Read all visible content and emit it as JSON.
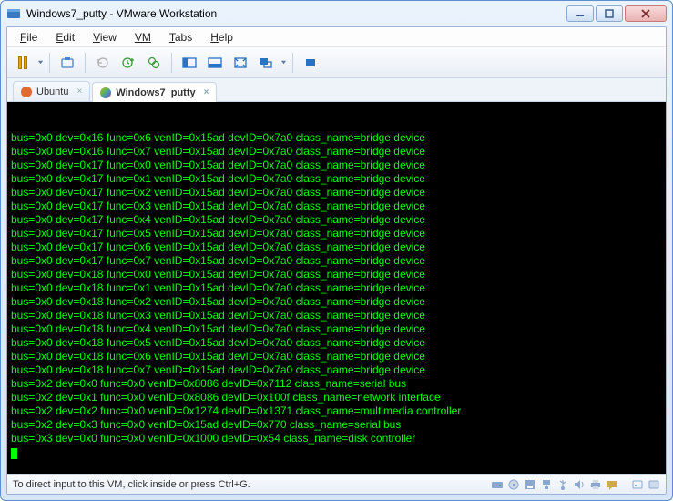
{
  "window": {
    "title": "Windows7_putty - VMware Workstation"
  },
  "menu": {
    "file": "File",
    "edit": "Edit",
    "view": "View",
    "vm": "VM",
    "tabs": "Tabs",
    "help": "Help"
  },
  "tabs": [
    {
      "label": "Ubuntu",
      "active": false,
      "icon_color": "#e26a2c"
    },
    {
      "label": "Windows7_putty",
      "active": true,
      "icon_color": "#2a72c4"
    }
  ],
  "terminal": {
    "lines": [
      "bus=0x0 dev=0x16 func=0x6 venID=0x15ad devID=0x7a0 class_name=bridge device",
      "bus=0x0 dev=0x16 func=0x7 venID=0x15ad devID=0x7a0 class_name=bridge device",
      "bus=0x0 dev=0x17 func=0x0 venID=0x15ad devID=0x7a0 class_name=bridge device",
      "bus=0x0 dev=0x17 func=0x1 venID=0x15ad devID=0x7a0 class_name=bridge device",
      "bus=0x0 dev=0x17 func=0x2 venID=0x15ad devID=0x7a0 class_name=bridge device",
      "bus=0x0 dev=0x17 func=0x3 venID=0x15ad devID=0x7a0 class_name=bridge device",
      "bus=0x0 dev=0x17 func=0x4 venID=0x15ad devID=0x7a0 class_name=bridge device",
      "bus=0x0 dev=0x17 func=0x5 venID=0x15ad devID=0x7a0 class_name=bridge device",
      "bus=0x0 dev=0x17 func=0x6 venID=0x15ad devID=0x7a0 class_name=bridge device",
      "bus=0x0 dev=0x17 func=0x7 venID=0x15ad devID=0x7a0 class_name=bridge device",
      "bus=0x0 dev=0x18 func=0x0 venID=0x15ad devID=0x7a0 class_name=bridge device",
      "bus=0x0 dev=0x18 func=0x1 venID=0x15ad devID=0x7a0 class_name=bridge device",
      "bus=0x0 dev=0x18 func=0x2 venID=0x15ad devID=0x7a0 class_name=bridge device",
      "bus=0x0 dev=0x18 func=0x3 venID=0x15ad devID=0x7a0 class_name=bridge device",
      "bus=0x0 dev=0x18 func=0x4 venID=0x15ad devID=0x7a0 class_name=bridge device",
      "bus=0x0 dev=0x18 func=0x5 venID=0x15ad devID=0x7a0 class_name=bridge device",
      "bus=0x0 dev=0x18 func=0x6 venID=0x15ad devID=0x7a0 class_name=bridge device",
      "bus=0x0 dev=0x18 func=0x7 venID=0x15ad devID=0x7a0 class_name=bridge device",
      "bus=0x2 dev=0x0 func=0x0 venID=0x8086 devID=0x7112 class_name=serial bus",
      "bus=0x2 dev=0x1 func=0x0 venID=0x8086 devID=0x100f class_name=network interface",
      "bus=0x2 dev=0x2 func=0x0 venID=0x1274 devID=0x1371 class_name=multimedia controller",
      "bus=0x2 dev=0x3 func=0x0 venID=0x15ad devID=0x770 class_name=serial bus",
      "bus=0x3 dev=0x0 func=0x0 venID=0x1000 devID=0x54 class_name=disk controller"
    ]
  },
  "status": {
    "hint": "To direct input to this VM, click inside or press Ctrl+G."
  }
}
